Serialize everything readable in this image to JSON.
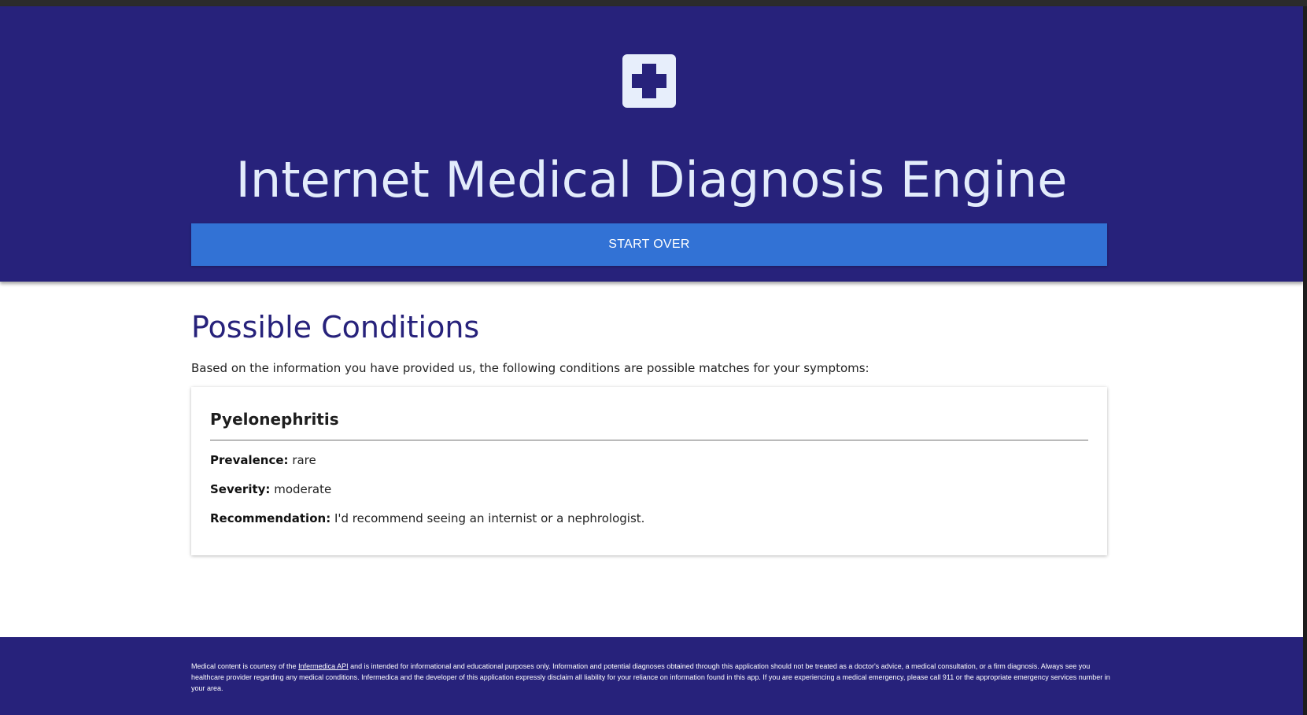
{
  "header": {
    "logo_icon": "medical-cross-icon",
    "title": "Internet Medical Diagnosis Engine",
    "start_over_label": "START OVER"
  },
  "main": {
    "section_title": "Possible Conditions",
    "intro": "Based on the information you have provided us, the following conditions are possible matches for your symptoms:",
    "conditions": [
      {
        "name": "Pyelonephritis",
        "prevalence_label": "Prevalence:",
        "prevalence": "rare",
        "severity_label": "Severity:",
        "severity": "moderate",
        "recommendation_label": "Recommendation:",
        "recommendation": "I'd recommend seeing an internist or a nephrologist."
      }
    ]
  },
  "footer": {
    "text_before_link": "Medical content is courtesy of the",
    "link_text": "Infermedica API",
    "text_after_link": "and is intended for informational and educational purposes only. Information and potential diagnoses obtained through this application should not be treated as a doctor's advice, a medical consultation, or a firm diagnosis. Always see you healthcare provider regarding any medical conditions. Infermedica and the developer of this application expressly disclaim all liability for your reliance on information found in this app. If you are experiencing a medical emergency, please call 911 or the appropriate emergency services number in your area."
  },
  "colors": {
    "header_bg": "#27227b",
    "accent_button": "#3272d5",
    "title_text": "#e3ecfb"
  }
}
